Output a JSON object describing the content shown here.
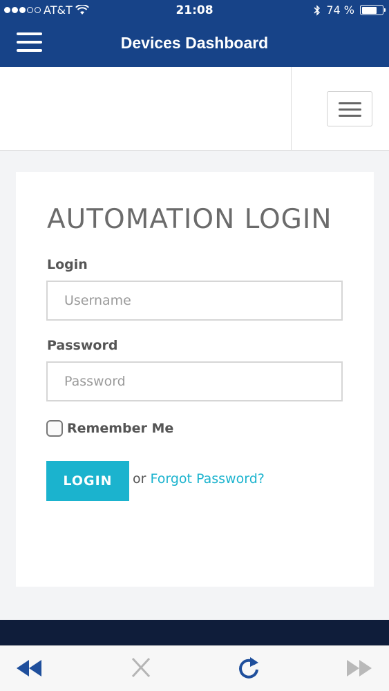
{
  "status_bar": {
    "carrier": "AT&T",
    "time": "21:08",
    "battery": "74 %",
    "battery_level": 0.74,
    "signal_bars": 3,
    "signal_max": 5
  },
  "app_bar": {
    "title": "Devices Dashboard"
  },
  "login": {
    "heading": "AUTOMATION LOGIN",
    "login_label": "Login",
    "username_placeholder": "Username",
    "username_value": "",
    "password_label": "Password",
    "password_placeholder": "Password",
    "password_value": "",
    "remember_label": "Remember Me",
    "remember_checked": false,
    "login_button": "LOGIN",
    "or_text": "or",
    "forgot_link": "Forgot Password?"
  },
  "icons": {
    "menu": "hamburger-menu-icon",
    "nav_toggle": "hamburger-menu-icon",
    "back": "rewind-icon",
    "stop": "close-icon",
    "reload": "reload-icon",
    "forward": "fast-forward-icon",
    "wifi": "wifi-icon",
    "bluetooth": "bluetooth-icon",
    "battery": "battery-icon"
  },
  "colors": {
    "app_bar": "#174388",
    "accent": "#1bb3ce",
    "footer": "#0f1d3a"
  }
}
